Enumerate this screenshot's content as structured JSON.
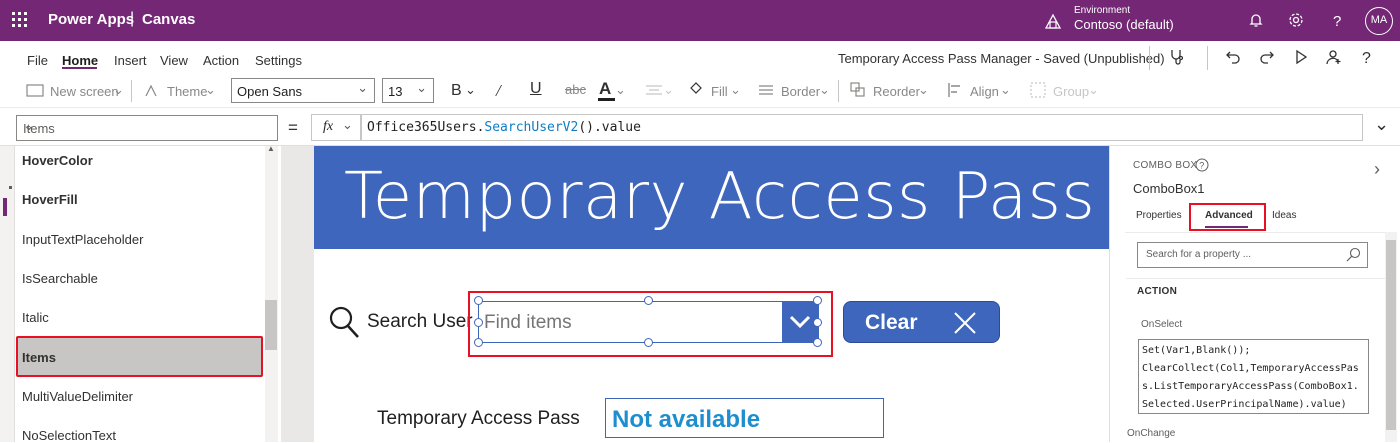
{
  "topbar": {
    "brand": "Power Apps",
    "separator": "|",
    "mode": "Canvas",
    "environment_label": "Environment",
    "environment_name": "Contoso (default)",
    "avatar_initials": "MA"
  },
  "menubar": {
    "items": [
      "File",
      "Home",
      "Insert",
      "View",
      "Action",
      "Settings"
    ],
    "active": "Home",
    "app_title": "Temporary Access Pass Manager - Saved (Unpublished)"
  },
  "ribbon": {
    "new_screen": "New screen",
    "theme": "Theme",
    "font": "Open Sans",
    "font_size": "13",
    "bold_glyph": "B",
    "fill": "Fill",
    "border": "Border",
    "reorder": "Reorder",
    "align": "Align",
    "group": "Group"
  },
  "formula_bar": {
    "property": "Items",
    "equals": "=",
    "fx": "fx",
    "formula_prefix": "Office365Users.",
    "formula_fn": "SearchUserV2",
    "formula_suffix": "().value"
  },
  "property_list": {
    "items": [
      "HoverColor",
      "HoverFill",
      "InputTextPlaceholder",
      "IsSearchable",
      "Italic",
      "Items",
      "MultiValueDelimiter",
      "NoSelectionText"
    ],
    "selected": "Items"
  },
  "canvas": {
    "banner_title": "Temporary Access Pass Ma",
    "search_label": "Search User",
    "combo_placeholder": "Find items",
    "clear_button": "Clear",
    "tap_label": "Temporary Access Pass",
    "tap_value": "Not available",
    "accent_color": "#3f66bd"
  },
  "right_pane": {
    "type": "COMBO BOX",
    "control_name": "ComboBox1",
    "tabs": [
      "Properties",
      "Advanced",
      "Ideas"
    ],
    "active_tab": "Advanced",
    "search_placeholder": "Search for a property ...",
    "section": "ACTION",
    "onselect_label": "OnSelect",
    "onselect_code": "Set(Var1,Blank());\nClearCollect(Col1,TemporaryAccessPas\ns.ListTemporaryAccessPass(ComboBox1.\nSelected.UserPrincipalName).value)",
    "onchange_label": "OnChange"
  },
  "colors": {
    "brand": "#742774",
    "highlight": "#e81123"
  }
}
